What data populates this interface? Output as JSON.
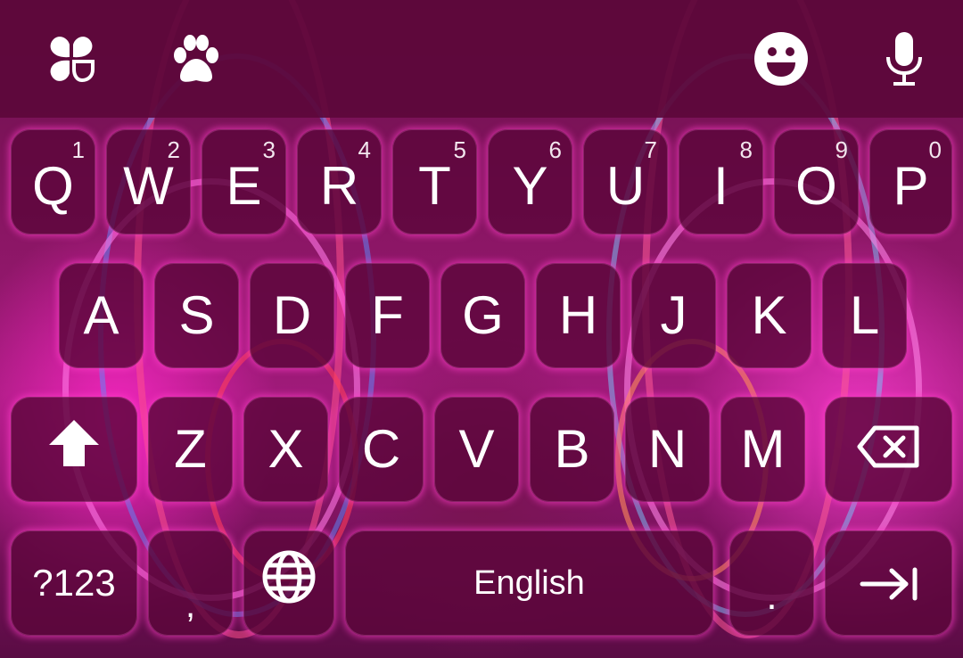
{
  "toolbar": {
    "icons": [
      "clover-icon",
      "paw-icon",
      "emoji-icon",
      "microphone-icon"
    ]
  },
  "rows": [
    [
      {
        "label": "Q",
        "hint": "1"
      },
      {
        "label": "W",
        "hint": "2"
      },
      {
        "label": "E",
        "hint": "3"
      },
      {
        "label": "R",
        "hint": "4"
      },
      {
        "label": "T",
        "hint": "5"
      },
      {
        "label": "Y",
        "hint": "6"
      },
      {
        "label": "U",
        "hint": "7"
      },
      {
        "label": "I",
        "hint": "8"
      },
      {
        "label": "O",
        "hint": "9"
      },
      {
        "label": "P",
        "hint": "0"
      }
    ],
    [
      {
        "label": "A"
      },
      {
        "label": "S"
      },
      {
        "label": "D"
      },
      {
        "label": "F"
      },
      {
        "label": "G"
      },
      {
        "label": "H"
      },
      {
        "label": "J"
      },
      {
        "label": "K"
      },
      {
        "label": "L"
      }
    ],
    [
      {
        "label": "Z"
      },
      {
        "label": "X"
      },
      {
        "label": "C"
      },
      {
        "label": "V"
      },
      {
        "label": "B"
      },
      {
        "label": "N"
      },
      {
        "label": "M"
      }
    ]
  ],
  "bottom_row": {
    "symbols_label": "?123",
    "comma_label": ",",
    "space_label": "English",
    "period_label": "."
  },
  "icons": {
    "shift": "shift-icon",
    "backspace": "backspace-icon",
    "globe": "globe-icon",
    "enter": "tab-arrow-icon"
  },
  "colors": {
    "key_fill": "#5c063a",
    "key_glow": "#ff3cc8",
    "toolbar": "#5c083a",
    "text": "#ffffff"
  }
}
